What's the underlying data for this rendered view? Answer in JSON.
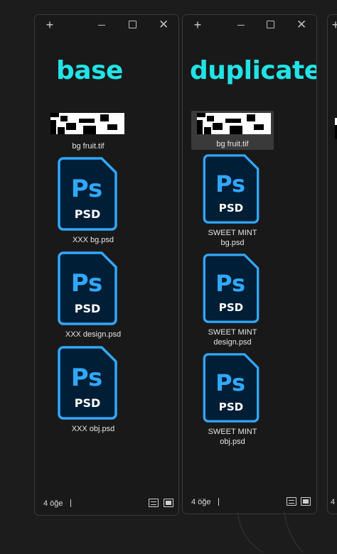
{
  "windows": [
    {
      "folder_title": "base",
      "items": [
        {
          "label_lines": [
            "bg fruit.tif"
          ],
          "icon": "tif-thumbnail"
        },
        {
          "label_lines": [
            "XXX bg.psd"
          ],
          "icon": "psd-file-icon",
          "icon_text": "Ps",
          "icon_sub": "PSD"
        },
        {
          "label_lines": [
            "XXX design.psd"
          ],
          "icon": "psd-file-icon",
          "icon_text": "Ps",
          "icon_sub": "PSD"
        },
        {
          "label_lines": [
            "XXX obj.psd"
          ],
          "icon": "psd-file-icon",
          "icon_text": "Ps",
          "icon_sub": "PSD"
        }
      ],
      "status": "4 öğe"
    },
    {
      "folder_title": "duplicate",
      "items": [
        {
          "label_lines": [
            "bg fruit.tif"
          ],
          "icon": "tif-thumbnail",
          "selected": true
        },
        {
          "label_lines": [
            "SWEET MINT",
            "bg.psd"
          ],
          "icon": "psd-file-icon",
          "icon_text": "Ps",
          "icon_sub": "PSD"
        },
        {
          "label_lines": [
            "SWEET MINT",
            "design.psd"
          ],
          "icon": "psd-file-icon",
          "icon_text": "Ps",
          "icon_sub": "PSD"
        },
        {
          "label_lines": [
            "SWEET MINT",
            "obj.psd"
          ],
          "icon": "psd-file-icon",
          "icon_text": "Ps",
          "icon_sub": "PSD"
        }
      ],
      "status": "4 öğe"
    },
    {
      "status": "4"
    }
  ],
  "titlebar": {
    "new_tab": "+",
    "close": "✕"
  },
  "colors": {
    "accent_title": "#22e3e6",
    "psd_blue": "#31a8ff",
    "psd_bg": "#001e36",
    "window_bg": "#191919",
    "desktop_bg": "#1c1c1c"
  }
}
